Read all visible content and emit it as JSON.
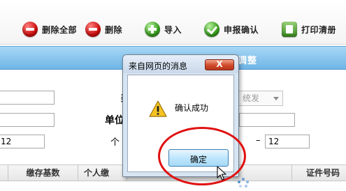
{
  "toolbar": {
    "items": [
      {
        "label": "删除全部",
        "icon": "remove-all-icon"
      },
      {
        "label": "删除",
        "icon": "delete-icon"
      },
      {
        "label": "导入",
        "icon": "import-icon"
      },
      {
        "label": "申报确认",
        "icon": "confirm-icon"
      },
      {
        "label": "打印清册",
        "icon": "print-icon"
      }
    ]
  },
  "header": {
    "title_fragment": "调整"
  },
  "form": {
    "label_partial_1": "类",
    "label_unit": "单位",
    "label_partial_2": "个",
    "select_value": "统发",
    "range_dash": "–",
    "range_left_value": "12",
    "range_right_value": "12"
  },
  "grid": {
    "columns": [
      "缴存基数",
      "个人缴",
      "证件号码"
    ]
  },
  "dialog": {
    "title": "来自网页的消息",
    "close_glyph": "X",
    "message": "确认成功",
    "ok_label": "确定",
    "icon": "warning-icon"
  },
  "colors": {
    "header_blue": "#6eb5e6",
    "dialog_frame": "#d7e4f2",
    "highlight": "#e01010"
  }
}
